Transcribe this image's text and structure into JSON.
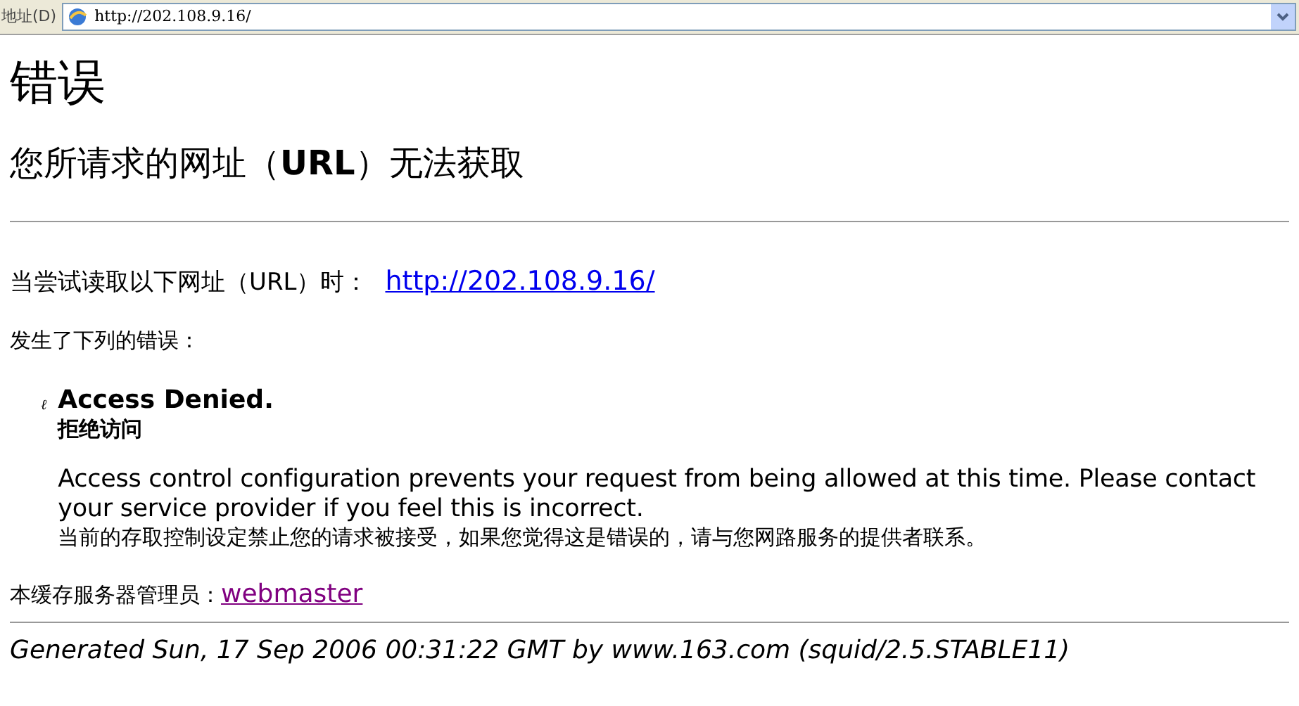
{
  "address_bar": {
    "label": "地址(D)",
    "url": "http://202.108.9.16/"
  },
  "page": {
    "title": "错误",
    "subtitle": "您所请求的网址（**URL**）无法获取",
    "request_label": "当尝试读取以下网址（URL）时：",
    "request_link": "http://202.108.9.16/",
    "error_intro": "发生了下列的错误：",
    "error": {
      "bullet": "ℓ",
      "heading": "Access Denied.",
      "heading_cn": "拒绝访问",
      "message": "Access control configuration prevents your request from being allowed at this time. Please contact your service provider if you feel this is incorrect.",
      "message_cn": "当前的存取控制设定禁止您的请求被接受，如果您觉得这是错误的，请与您网路服务的提供者联系。"
    },
    "admin_label": "本缓存服务器管理员：",
    "admin_link": "webmaster",
    "footer": "Generated Sun, 17 Sep 2006 00:31:22 GMT by www.163.com (squid/2.5.STABLE11)"
  }
}
